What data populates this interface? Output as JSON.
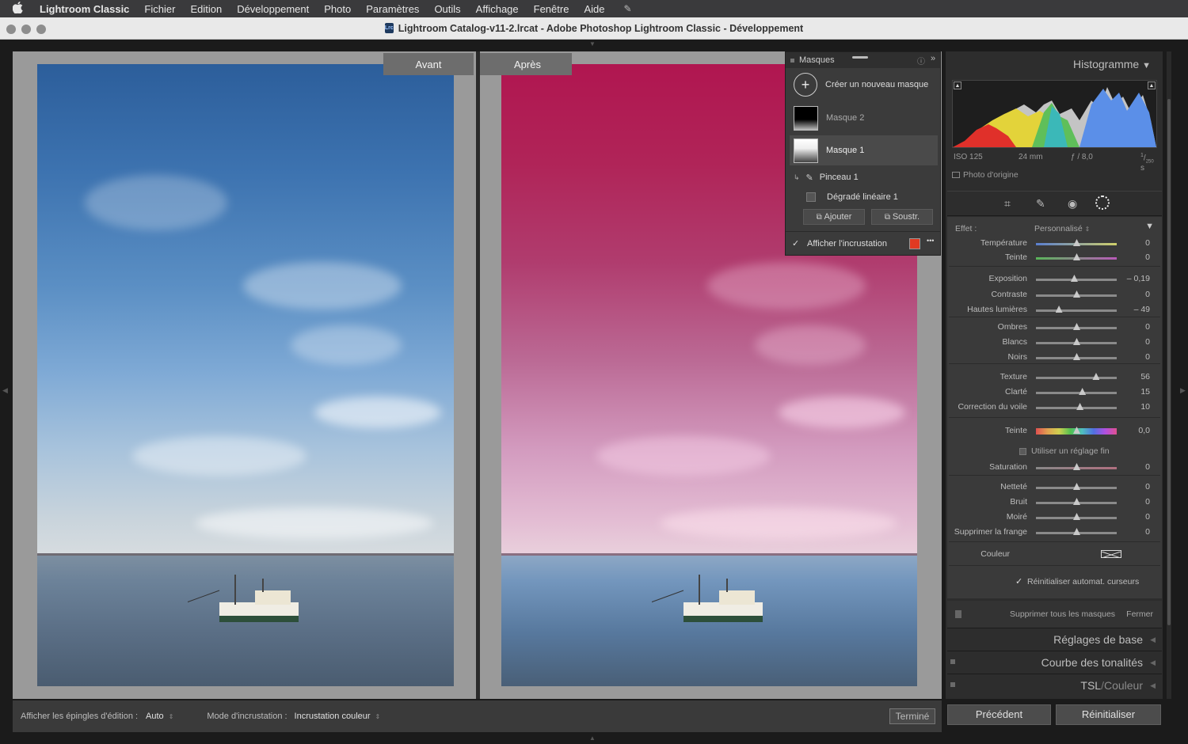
{
  "menubar": {
    "items": [
      "Lightroom Classic",
      "Fichier",
      "Edition",
      "Développement",
      "Photo",
      "Paramètres",
      "Outils",
      "Affichage",
      "Fenêtre",
      "Aide"
    ]
  },
  "window": {
    "title": "Lightroom Catalog-v11-2.lrcat - Adobe Photoshop Lightroom Classic - Développement",
    "icon_text": "Lrc"
  },
  "view": {
    "before_label": "Avant",
    "after_label": "Après"
  },
  "bottom_toolbar": {
    "pins_label": "Afficher les épingles d'édition :",
    "pins_value": "Auto",
    "overlay_label": "Mode d'incrustation :",
    "overlay_value": "Incrustation couleur",
    "done_button": "Terminé"
  },
  "masks_panel": {
    "title": "Masques",
    "create_new": "Créer un nouveau masque",
    "masks": [
      {
        "name": "Masque 2"
      },
      {
        "name": "Masque 1"
      }
    ],
    "components": [
      {
        "name": "Pinceau 1"
      },
      {
        "name": "Dégradé linéaire 1"
      }
    ],
    "add_button": "Ajouter",
    "subtract_button": "Soustr.",
    "show_overlay_label": "Afficher l'incrustation",
    "overlay_color": "#e03a22",
    "more_symbol": "•••"
  },
  "histogram": {
    "title": "Histogramme",
    "iso": "ISO 125",
    "focal": "24 mm",
    "aperture": "ƒ / 8,0",
    "shutter_num": "1",
    "shutter_den": "250",
    "shutter_unit": "s",
    "original_photo_label": "Photo d'origine"
  },
  "mask_adjustments": {
    "effect_label": "Effet :",
    "effect_value": "Personnalisé",
    "sliders": [
      {
        "label": "Température",
        "value": "0",
        "pos": 0.5
      },
      {
        "label": "Teinte",
        "value": "0",
        "pos": 0.5
      },
      {
        "label": "Exposition",
        "value": "– 0,19",
        "pos": 0.47
      },
      {
        "label": "Contraste",
        "value": "0",
        "pos": 0.5
      },
      {
        "label": "Hautes lumières",
        "value": "– 49",
        "pos": 0.28
      },
      {
        "label": "Ombres",
        "value": "0",
        "pos": 0.5
      },
      {
        "label": "Blancs",
        "value": "0",
        "pos": 0.5
      },
      {
        "label": "Noirs",
        "value": "0",
        "pos": 0.5
      },
      {
        "label": "Texture",
        "value": "56",
        "pos": 0.74
      },
      {
        "label": "Clarté",
        "value": "15",
        "pos": 0.57
      },
      {
        "label": "Correction du voile",
        "value": "10",
        "pos": 0.54
      },
      {
        "label": "Teinte",
        "value": "0,0",
        "pos": 0.5
      },
      {
        "label": "Saturation",
        "value": "0",
        "pos": 0.5
      },
      {
        "label": "Netteté",
        "value": "0",
        "pos": 0.5
      },
      {
        "label": "Bruit",
        "value": "0",
        "pos": 0.5
      },
      {
        "label": "Moiré",
        "value": "0",
        "pos": 0.5
      },
      {
        "label": "Supprimer la frange",
        "value": "0",
        "pos": 0.5
      }
    ],
    "fine_adjust_label": "Utiliser un réglage fin",
    "color_label": "Couleur",
    "auto_reset_label": "Réinitialiser automat. curseurs",
    "delete_all_label": "Supprimer tous les masques",
    "close_label": "Fermer"
  },
  "sections": {
    "basic": "Réglages de base",
    "tone_curve": "Courbe des tonalités",
    "hsl_a": "TSL",
    "hsl_sep": "/",
    "hsl_b": "Couleur"
  },
  "footer_buttons": {
    "previous": "Précédent",
    "reset": "Réinitialiser"
  }
}
